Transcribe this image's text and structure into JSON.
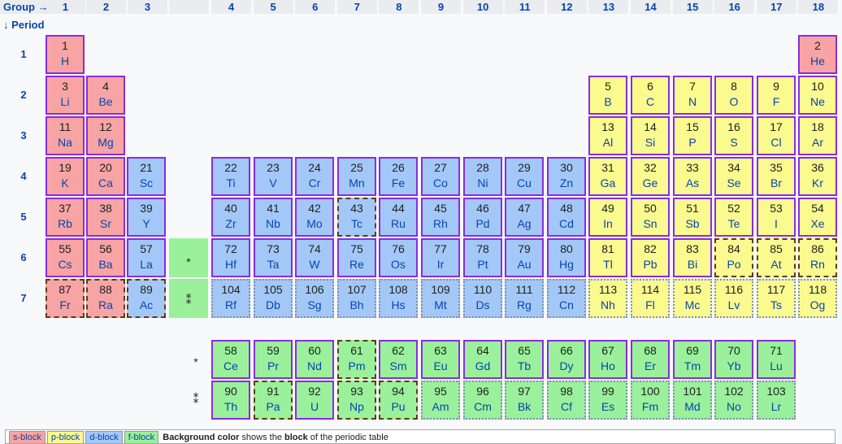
{
  "header": {
    "group_label": "Group →",
    "period_label": "↓ Period",
    "groups": [
      "1",
      "2",
      "3",
      "",
      "4",
      "5",
      "6",
      "7",
      "8",
      "9",
      "10",
      "11",
      "12",
      "13",
      "14",
      "15",
      "16",
      "17",
      "18"
    ],
    "periods": [
      "1",
      "2",
      "3",
      "4",
      "5",
      "6",
      "7"
    ]
  },
  "blocks": {
    "s": "#f8a4a4",
    "p": "#fafa8f",
    "d": "#a3c8f7",
    "f": "#9bf09b"
  },
  "main_table": [
    {
      "n": "1",
      "s": "H",
      "g": 1,
      "p": 1,
      "b": "s"
    },
    {
      "n": "2",
      "s": "He",
      "g": 18,
      "p": 1,
      "b": "s"
    },
    {
      "n": "3",
      "s": "Li",
      "g": 1,
      "p": 2,
      "b": "s"
    },
    {
      "n": "4",
      "s": "Be",
      "g": 2,
      "p": 2,
      "b": "s"
    },
    {
      "n": "5",
      "s": "B",
      "g": 13,
      "p": 2,
      "b": "p"
    },
    {
      "n": "6",
      "s": "C",
      "g": 14,
      "p": 2,
      "b": "p"
    },
    {
      "n": "7",
      "s": "N",
      "g": 15,
      "p": 2,
      "b": "p"
    },
    {
      "n": "8",
      "s": "O",
      "g": 16,
      "p": 2,
      "b": "p"
    },
    {
      "n": "9",
      "s": "F",
      "g": 17,
      "p": 2,
      "b": "p"
    },
    {
      "n": "10",
      "s": "Ne",
      "g": 18,
      "p": 2,
      "b": "p"
    },
    {
      "n": "11",
      "s": "Na",
      "g": 1,
      "p": 3,
      "b": "s"
    },
    {
      "n": "12",
      "s": "Mg",
      "g": 2,
      "p": 3,
      "b": "s"
    },
    {
      "n": "13",
      "s": "Al",
      "g": 13,
      "p": 3,
      "b": "p"
    },
    {
      "n": "14",
      "s": "Si",
      "g": 14,
      "p": 3,
      "b": "p"
    },
    {
      "n": "15",
      "s": "P",
      "g": 15,
      "p": 3,
      "b": "p"
    },
    {
      "n": "16",
      "s": "S",
      "g": 16,
      "p": 3,
      "b": "p"
    },
    {
      "n": "17",
      "s": "Cl",
      "g": 17,
      "p": 3,
      "b": "p"
    },
    {
      "n": "18",
      "s": "Ar",
      "g": 18,
      "p": 3,
      "b": "p"
    },
    {
      "n": "19",
      "s": "K",
      "g": 1,
      "p": 4,
      "b": "s"
    },
    {
      "n": "20",
      "s": "Ca",
      "g": 2,
      "p": 4,
      "b": "s"
    },
    {
      "n": "21",
      "s": "Sc",
      "g": 3,
      "p": 4,
      "b": "d"
    },
    {
      "n": "22",
      "s": "Ti",
      "g": 4,
      "p": 4,
      "b": "d"
    },
    {
      "n": "23",
      "s": "V",
      "g": 5,
      "p": 4,
      "b": "d"
    },
    {
      "n": "24",
      "s": "Cr",
      "g": 6,
      "p": 4,
      "b": "d"
    },
    {
      "n": "25",
      "s": "Mn",
      "g": 7,
      "p": 4,
      "b": "d"
    },
    {
      "n": "26",
      "s": "Fe",
      "g": 8,
      "p": 4,
      "b": "d"
    },
    {
      "n": "27",
      "s": "Co",
      "g": 9,
      "p": 4,
      "b": "d"
    },
    {
      "n": "28",
      "s": "Ni",
      "g": 10,
      "p": 4,
      "b": "d"
    },
    {
      "n": "29",
      "s": "Cu",
      "g": 11,
      "p": 4,
      "b": "d"
    },
    {
      "n": "30",
      "s": "Zn",
      "g": 12,
      "p": 4,
      "b": "d"
    },
    {
      "n": "31",
      "s": "Ga",
      "g": 13,
      "p": 4,
      "b": "p"
    },
    {
      "n": "32",
      "s": "Ge",
      "g": 14,
      "p": 4,
      "b": "p"
    },
    {
      "n": "33",
      "s": "As",
      "g": 15,
      "p": 4,
      "b": "p"
    },
    {
      "n": "34",
      "s": "Se",
      "g": 16,
      "p": 4,
      "b": "p"
    },
    {
      "n": "35",
      "s": "Br",
      "g": 17,
      "p": 4,
      "b": "p"
    },
    {
      "n": "36",
      "s": "Kr",
      "g": 18,
      "p": 4,
      "b": "p"
    },
    {
      "n": "37",
      "s": "Rb",
      "g": 1,
      "p": 5,
      "b": "s"
    },
    {
      "n": "38",
      "s": "Sr",
      "g": 2,
      "p": 5,
      "b": "s"
    },
    {
      "n": "39",
      "s": "Y",
      "g": 3,
      "p": 5,
      "b": "d"
    },
    {
      "n": "40",
      "s": "Zr",
      "g": 4,
      "p": 5,
      "b": "d"
    },
    {
      "n": "41",
      "s": "Nb",
      "g": 5,
      "p": 5,
      "b": "d"
    },
    {
      "n": "42",
      "s": "Mo",
      "g": 6,
      "p": 5,
      "b": "d"
    },
    {
      "n": "43",
      "s": "Tc",
      "g": 7,
      "p": 5,
      "b": "d",
      "border": "dash"
    },
    {
      "n": "44",
      "s": "Ru",
      "g": 8,
      "p": 5,
      "b": "d"
    },
    {
      "n": "45",
      "s": "Rh",
      "g": 9,
      "p": 5,
      "b": "d"
    },
    {
      "n": "46",
      "s": "Pd",
      "g": 10,
      "p": 5,
      "b": "d"
    },
    {
      "n": "47",
      "s": "Ag",
      "g": 11,
      "p": 5,
      "b": "d"
    },
    {
      "n": "48",
      "s": "Cd",
      "g": 12,
      "p": 5,
      "b": "d"
    },
    {
      "n": "49",
      "s": "In",
      "g": 13,
      "p": 5,
      "b": "p"
    },
    {
      "n": "50",
      "s": "Sn",
      "g": 14,
      "p": 5,
      "b": "p"
    },
    {
      "n": "51",
      "s": "Sb",
      "g": 15,
      "p": 5,
      "b": "p"
    },
    {
      "n": "52",
      "s": "Te",
      "g": 16,
      "p": 5,
      "b": "p"
    },
    {
      "n": "53",
      "s": "I",
      "g": 17,
      "p": 5,
      "b": "p"
    },
    {
      "n": "54",
      "s": "Xe",
      "g": 18,
      "p": 5,
      "b": "p"
    },
    {
      "n": "55",
      "s": "Cs",
      "g": 1,
      "p": 6,
      "b": "s"
    },
    {
      "n": "56",
      "s": "Ba",
      "g": 2,
      "p": 6,
      "b": "s"
    },
    {
      "n": "57",
      "s": "La",
      "g": 3,
      "p": 6,
      "b": "d"
    },
    {
      "n": "72",
      "s": "Hf",
      "g": 4,
      "p": 6,
      "b": "d"
    },
    {
      "n": "73",
      "s": "Ta",
      "g": 5,
      "p": 6,
      "b": "d"
    },
    {
      "n": "74",
      "s": "W",
      "g": 6,
      "p": 6,
      "b": "d"
    },
    {
      "n": "75",
      "s": "Re",
      "g": 7,
      "p": 6,
      "b": "d"
    },
    {
      "n": "76",
      "s": "Os",
      "g": 8,
      "p": 6,
      "b": "d"
    },
    {
      "n": "77",
      "s": "Ir",
      "g": 9,
      "p": 6,
      "b": "d"
    },
    {
      "n": "78",
      "s": "Pt",
      "g": 10,
      "p": 6,
      "b": "d"
    },
    {
      "n": "79",
      "s": "Au",
      "g": 11,
      "p": 6,
      "b": "d"
    },
    {
      "n": "80",
      "s": "Hg",
      "g": 12,
      "p": 6,
      "b": "d"
    },
    {
      "n": "81",
      "s": "Tl",
      "g": 13,
      "p": 6,
      "b": "p"
    },
    {
      "n": "82",
      "s": "Pb",
      "g": 14,
      "p": 6,
      "b": "p"
    },
    {
      "n": "83",
      "s": "Bi",
      "g": 15,
      "p": 6,
      "b": "p"
    },
    {
      "n": "84",
      "s": "Po",
      "g": 16,
      "p": 6,
      "b": "p",
      "border": "dash"
    },
    {
      "n": "85",
      "s": "At",
      "g": 17,
      "p": 6,
      "b": "p",
      "border": "dash"
    },
    {
      "n": "86",
      "s": "Rn",
      "g": 18,
      "p": 6,
      "b": "p",
      "border": "dash"
    },
    {
      "n": "87",
      "s": "Fr",
      "g": 1,
      "p": 7,
      "b": "s",
      "border": "dash"
    },
    {
      "n": "88",
      "s": "Ra",
      "g": 2,
      "p": 7,
      "b": "s",
      "border": "dash"
    },
    {
      "n": "89",
      "s": "Ac",
      "g": 3,
      "p": 7,
      "b": "d",
      "border": "dash"
    },
    {
      "n": "104",
      "s": "Rf",
      "g": 4,
      "p": 7,
      "b": "d",
      "border": "dot"
    },
    {
      "n": "105",
      "s": "Db",
      "g": 5,
      "p": 7,
      "b": "d",
      "border": "dot"
    },
    {
      "n": "106",
      "s": "Sg",
      "g": 6,
      "p": 7,
      "b": "d",
      "border": "dot"
    },
    {
      "n": "107",
      "s": "Bh",
      "g": 7,
      "p": 7,
      "b": "d",
      "border": "dot"
    },
    {
      "n": "108",
      "s": "Hs",
      "g": 8,
      "p": 7,
      "b": "d",
      "border": "dot"
    },
    {
      "n": "109",
      "s": "Mt",
      "g": 9,
      "p": 7,
      "b": "d",
      "border": "dot"
    },
    {
      "n": "110",
      "s": "Ds",
      "g": 10,
      "p": 7,
      "b": "d",
      "border": "dot"
    },
    {
      "n": "111",
      "s": "Rg",
      "g": 11,
      "p": 7,
      "b": "d",
      "border": "dot"
    },
    {
      "n": "112",
      "s": "Cn",
      "g": 12,
      "p": 7,
      "b": "d",
      "border": "dot"
    },
    {
      "n": "113",
      "s": "Nh",
      "g": 13,
      "p": 7,
      "b": "p",
      "border": "dot"
    },
    {
      "n": "114",
      "s": "Fl",
      "g": 14,
      "p": 7,
      "b": "p",
      "border": "dot"
    },
    {
      "n": "115",
      "s": "Mc",
      "g": 15,
      "p": 7,
      "b": "p",
      "border": "dot"
    },
    {
      "n": "116",
      "s": "Lv",
      "g": 16,
      "p": 7,
      "b": "p",
      "border": "dot"
    },
    {
      "n": "117",
      "s": "Ts",
      "g": 17,
      "p": 7,
      "b": "p",
      "border": "dot"
    },
    {
      "n": "118",
      "s": "Og",
      "g": 18,
      "p": 7,
      "b": "p",
      "border": "dot"
    }
  ],
  "markers": {
    "lanthanide": "*",
    "actinide": "⁑"
  },
  "lanthanides": [
    {
      "n": "58",
      "s": "Ce"
    },
    {
      "n": "59",
      "s": "Pr"
    },
    {
      "n": "60",
      "s": "Nd"
    },
    {
      "n": "61",
      "s": "Pm",
      "border": "dash"
    },
    {
      "n": "62",
      "s": "Sm"
    },
    {
      "n": "63",
      "s": "Eu"
    },
    {
      "n": "64",
      "s": "Gd"
    },
    {
      "n": "65",
      "s": "Tb"
    },
    {
      "n": "66",
      "s": "Dy"
    },
    {
      "n": "67",
      "s": "Ho"
    },
    {
      "n": "68",
      "s": "Er"
    },
    {
      "n": "69",
      "s": "Tm"
    },
    {
      "n": "70",
      "s": "Yb"
    },
    {
      "n": "71",
      "s": "Lu"
    }
  ],
  "actinides": [
    {
      "n": "90",
      "s": "Th"
    },
    {
      "n": "91",
      "s": "Pa",
      "border": "dash"
    },
    {
      "n": "92",
      "s": "U"
    },
    {
      "n": "93",
      "s": "Np",
      "border": "dash"
    },
    {
      "n": "94",
      "s": "Pu",
      "border": "dash"
    },
    {
      "n": "95",
      "s": "Am",
      "border": "dot"
    },
    {
      "n": "96",
      "s": "Cm",
      "border": "dot"
    },
    {
      "n": "97",
      "s": "Bk",
      "border": "dot"
    },
    {
      "n": "98",
      "s": "Cf",
      "border": "dot"
    },
    {
      "n": "99",
      "s": "Es",
      "border": "dot"
    },
    {
      "n": "100",
      "s": "Fm",
      "border": "dot"
    },
    {
      "n": "101",
      "s": "Md",
      "border": "dot"
    },
    {
      "n": "102",
      "s": "No",
      "border": "dot"
    },
    {
      "n": "103",
      "s": "Lr",
      "border": "dot"
    }
  ],
  "legend": {
    "chips": [
      {
        "label": "s-block",
        "b": "s"
      },
      {
        "label": "p-block",
        "b": "p"
      },
      {
        "label": "d-block",
        "b": "d"
      },
      {
        "label": "f-block",
        "b": "f"
      }
    ],
    "text_bold1": "Background color",
    "text_mid": " shows the ",
    "text_bold2": "block",
    "text_end": " of the periodic table"
  }
}
